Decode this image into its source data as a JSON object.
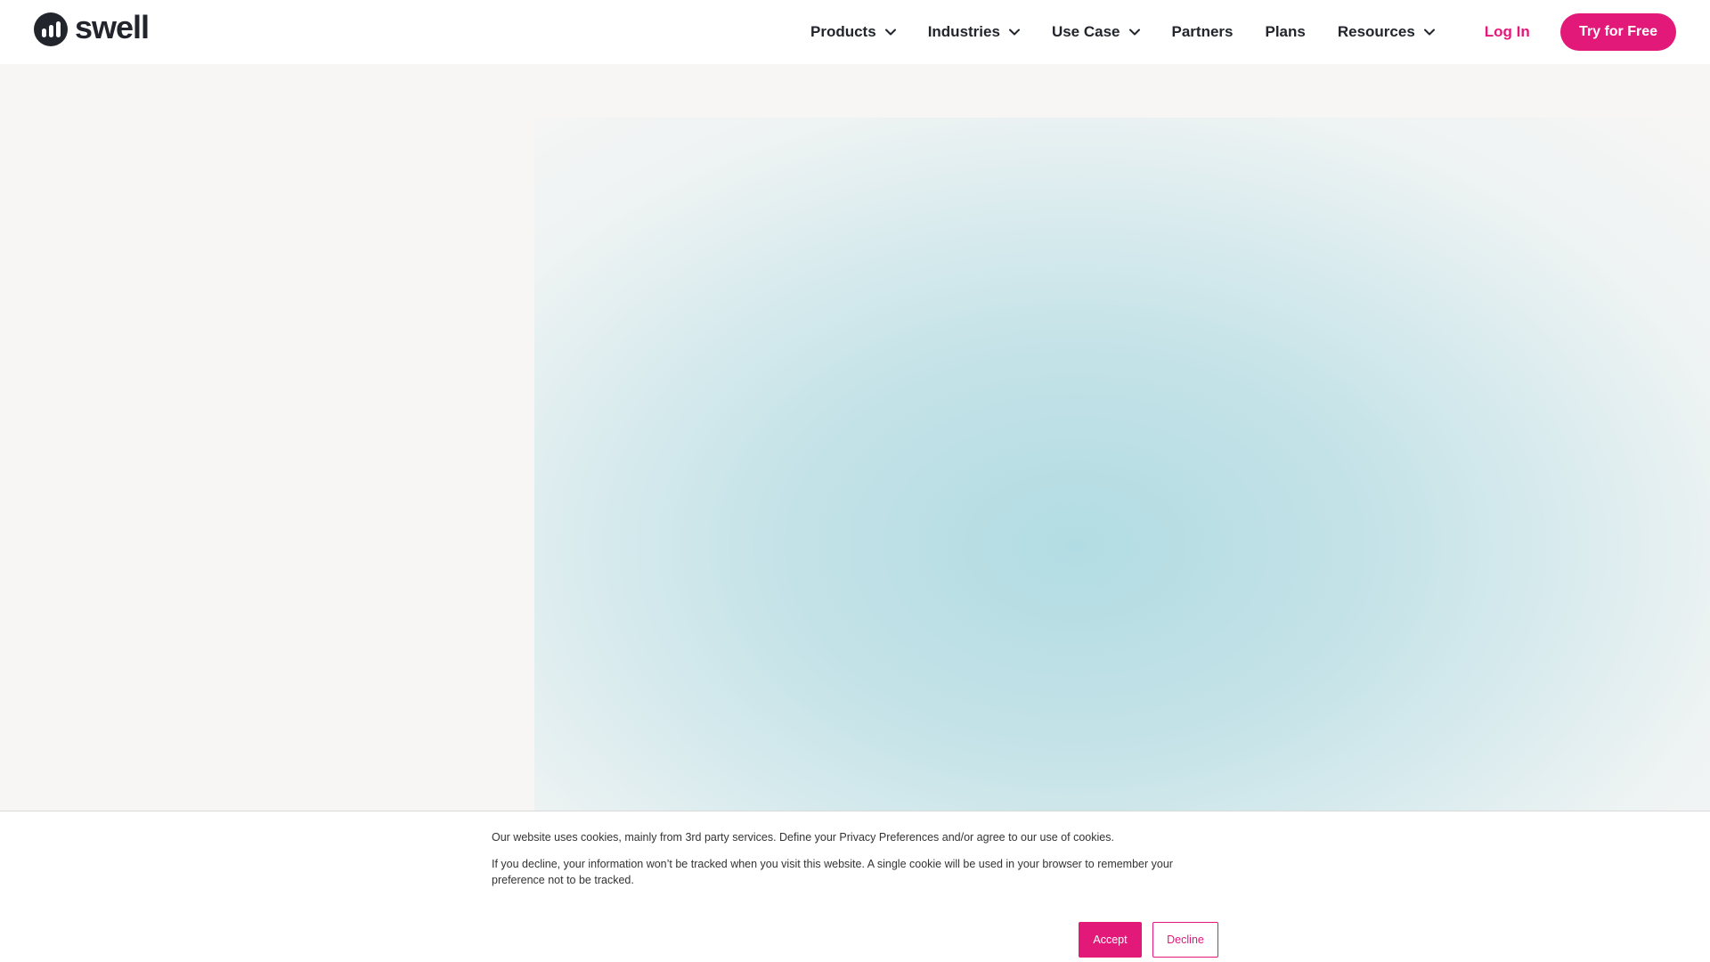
{
  "brand": {
    "name": "swell",
    "accent_color": "#e3197a",
    "dark_color": "#22252b"
  },
  "nav": {
    "items": [
      {
        "label": "Products",
        "has_dropdown": true,
        "icon": "chevron-down-icon"
      },
      {
        "label": "Industries",
        "has_dropdown": true,
        "icon": "chevron-down-icon"
      },
      {
        "label": "Use Case",
        "has_dropdown": true,
        "icon": "chevron-down-icon"
      },
      {
        "label": "Partners",
        "has_dropdown": false
      },
      {
        "label": "Plans",
        "has_dropdown": false
      },
      {
        "label": "Resources",
        "has_dropdown": true,
        "icon": "chevron-down-icon"
      }
    ],
    "login_label": "Log In",
    "cta_label": "Try for Free"
  },
  "cookie_banner": {
    "text_1": "Our website uses cookies, mainly from 3rd party services. Define your Privacy Preferences and/or agree to our use of cookies.",
    "text_2": "If you decline, your information won’t be tracked when you visit this website. A single cookie will be used in your browser to remember your preference not to be tracked.",
    "accept_label": "Accept",
    "decline_label": "Decline"
  }
}
